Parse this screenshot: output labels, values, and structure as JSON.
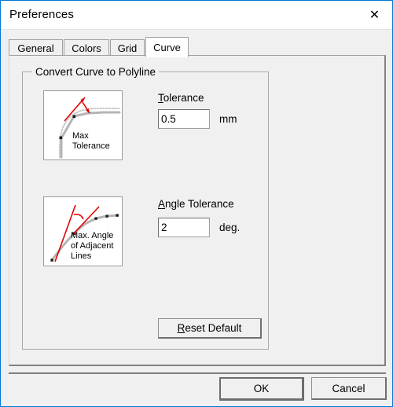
{
  "window": {
    "title": "Preferences",
    "close_icon": "close-icon",
    "accent_color": "#0078d7"
  },
  "tabs": [
    {
      "label": "General",
      "active": false
    },
    {
      "label": "Colors",
      "active": false
    },
    {
      "label": "Grid",
      "active": false
    },
    {
      "label": "Curve",
      "active": true
    }
  ],
  "group": {
    "title": "Convert Curve to Polyline"
  },
  "tolerance": {
    "label_accel": "T",
    "label_rest": "olerance",
    "value": "0.5",
    "unit": "mm",
    "diagram_caption_line1": "Max",
    "diagram_caption_line2": "Tolerance"
  },
  "angle_tolerance": {
    "label_accel": "A",
    "label_rest": "ngle Tolerance",
    "value": "2",
    "unit": "deg.",
    "diagram_caption_line1": "Max. Angle",
    "diagram_caption_line2": "of Adjacent",
    "diagram_caption_line3": "Lines"
  },
  "reset": {
    "label_accel": "R",
    "label_rest": "eset Default"
  },
  "footer": {
    "ok_label": "OK",
    "cancel_label": "Cancel"
  }
}
